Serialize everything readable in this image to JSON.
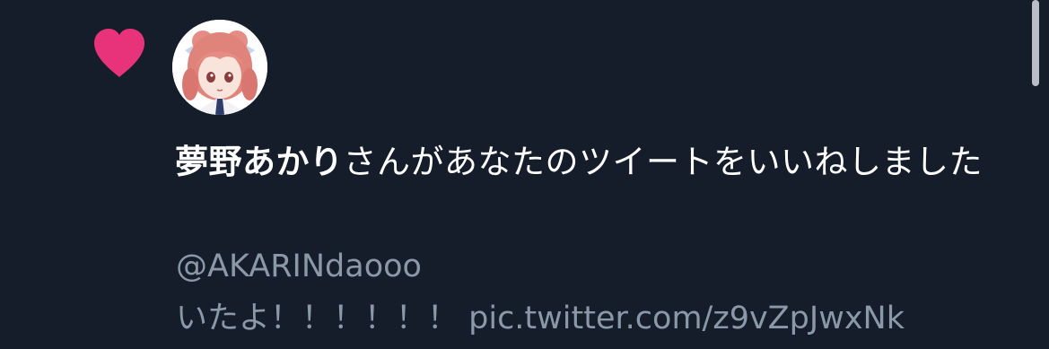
{
  "notification": {
    "type_icon": "heart-icon",
    "accent_color": "#e8337a",
    "avatar_icon": "user-avatar-anime-girl",
    "user_name": "夢野あかり",
    "message_suffix": "さんがあなたのツイートをいいねしました",
    "handle": "@AKARINdaooo",
    "tweet_text": "いたよ！！！！！！ pic.twitter.com/z9vZpJwxNk"
  },
  "colors": {
    "background": "#151d2a",
    "primary_text": "#ffffff",
    "secondary_text": "#8b98a8",
    "heart": "#e8337a"
  }
}
